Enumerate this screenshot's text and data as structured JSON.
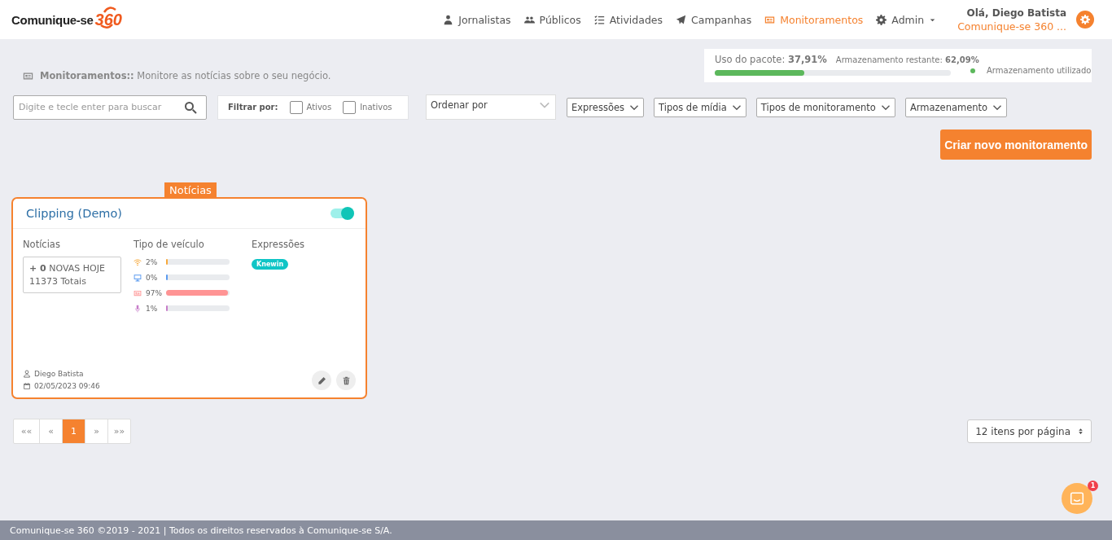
{
  "header": {
    "logo_text": "Comunique-se",
    "logo_number": "360",
    "nav": [
      {
        "label": "Jornalistas",
        "kind": "user",
        "selected": false,
        "dropdown": false
      },
      {
        "label": "Públicos",
        "kind": "users",
        "selected": false,
        "dropdown": false
      },
      {
        "label": "Atividades",
        "kind": "list",
        "selected": false,
        "dropdown": false
      },
      {
        "label": "Campanhas",
        "kind": "plane",
        "selected": false,
        "dropdown": false
      },
      {
        "label": "Monitoramentos",
        "kind": "news",
        "selected": true,
        "dropdown": false
      },
      {
        "label": "Admin",
        "kind": "gear",
        "selected": false,
        "dropdown": true
      }
    ],
    "greeting": "Olá, Diego Batista",
    "account": "Comunique-se 360 ..."
  },
  "page_title": {
    "label": "Monitoramentos::",
    "text": "Monitore as notícias sobre o seu negócio."
  },
  "usage": {
    "package_label": "Uso do pacote:",
    "package_value": "37,91%",
    "remaining_label": "Armazenamento restante:",
    "remaining_value": "62,09%",
    "level": 0.3791,
    "legend": "Armazenamento utilizado"
  },
  "search": {
    "placeholder": "Digite e tecle enter para buscar"
  },
  "filter": {
    "label": "Filtrar por:",
    "options": [
      {
        "label": "Ativos",
        "checked": false
      },
      {
        "label": "Inativos",
        "checked": false
      }
    ]
  },
  "sort": {
    "placeholder": "Ordenar por"
  },
  "dropdowns": [
    "Expressões",
    "Tipos de mídia",
    "Tipos de monitoramento",
    "Armazenamento"
  ],
  "create_button": "Criar novo monitoramento",
  "cards": [
    {
      "tag": "Notícias",
      "title": "Clipping (Demo)",
      "on": true,
      "news_label": "Notícias",
      "new_count": "+ 0",
      "new_label": "NOVAS HOJE",
      "total": "11373 Totais",
      "vehicle_label": "Tipo de veículo",
      "vehicles": [
        {
          "kind": "wifi",
          "reading": "2%",
          "level": 0.02,
          "color": "#f7a83a"
        },
        {
          "kind": "monitor",
          "reading": "0%",
          "level": 0.0,
          "color": "#5b9bf0"
        },
        {
          "kind": "news",
          "reading": "97%",
          "level": 0.97,
          "color": "#ff9494"
        },
        {
          "kind": "mic",
          "reading": "1%",
          "level": 0.01,
          "color": "#c77dc9"
        }
      ],
      "expressions_label": "Expressões",
      "expressions": [
        "Knewin"
      ],
      "author": "Diego Batista",
      "date": "02/05/2023 09:46"
    }
  ],
  "pagination": {
    "items": [
      {
        "label": "««",
        "selected": false
      },
      {
        "label": "«",
        "selected": false
      },
      {
        "label": "1",
        "selected": true
      },
      {
        "label": "»",
        "selected": false
      },
      {
        "label": "»»",
        "selected": false
      }
    ],
    "per_page": "12 itens por página"
  },
  "chat": {
    "badge": "1"
  },
  "footer": "Comunique-se 360 ©2019 - 2021 | Todos os direitos reservados à Comunique-se S/A."
}
